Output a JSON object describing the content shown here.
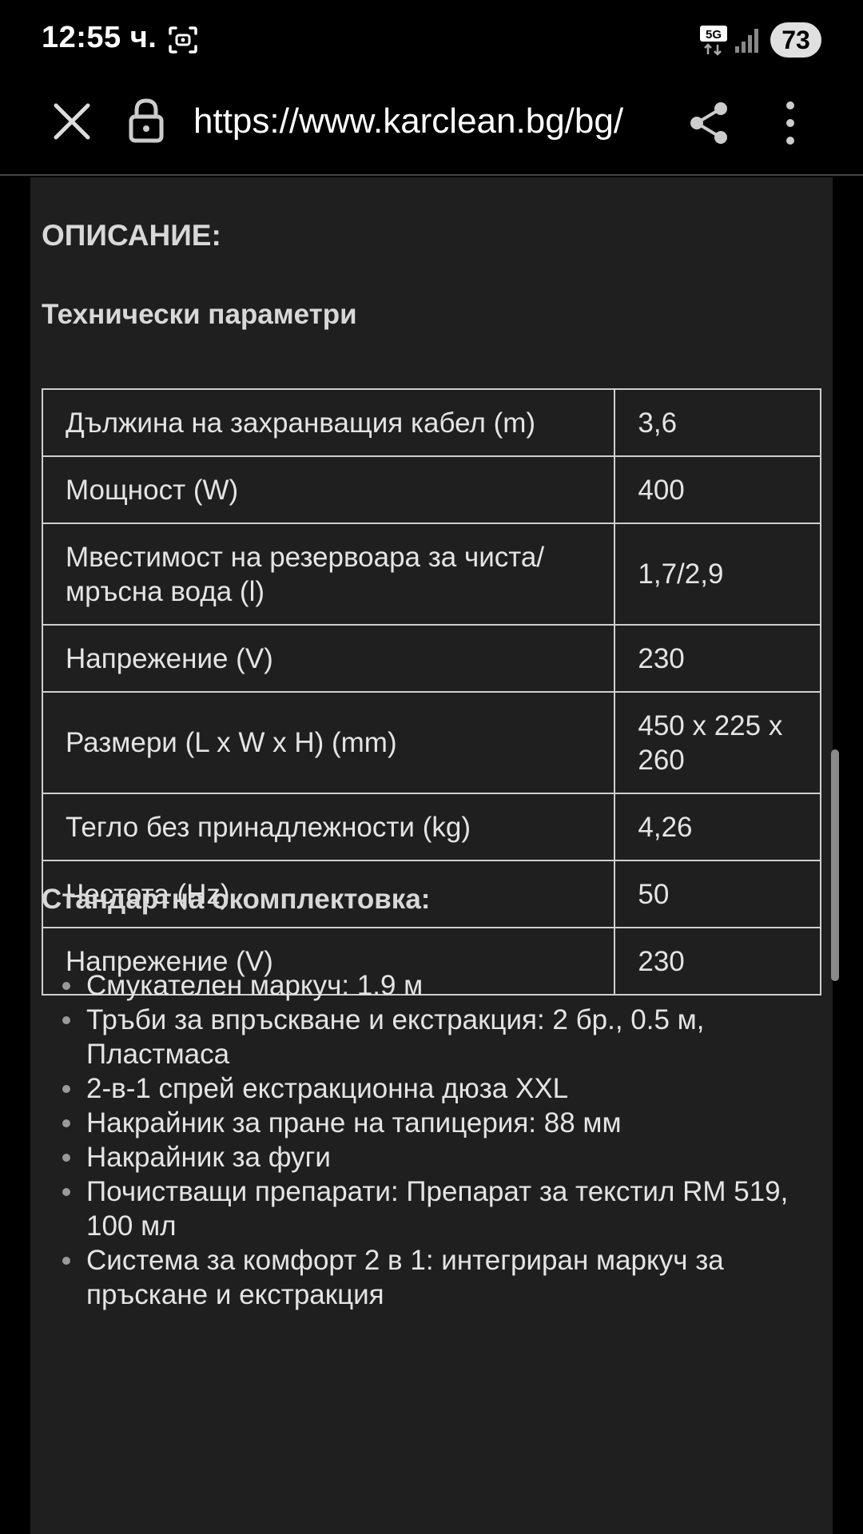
{
  "status_bar": {
    "time": "12:55 ч.",
    "network": "5G",
    "battery": "73",
    "icons": [
      "screenshot-icon",
      "5g-icon",
      "signal-icon",
      "battery-icon"
    ]
  },
  "toolbar": {
    "url": "https://www.karclean.bg/bg/",
    "icons": [
      "close-icon",
      "lock-icon",
      "share-icon",
      "more-vert-icon"
    ]
  },
  "content": {
    "description_heading": "ОПИСАНИЕ:",
    "tech_heading": "Технически параметри",
    "spec_table": [
      {
        "key": "Дължина на захранващия кабел (m)",
        "value": "3,6"
      },
      {
        "key": "Мощност (W)",
        "value": "400"
      },
      {
        "key": "Мвестимост на резервоара за чиста/ мръсна вода (l)",
        "value": "1,7/2,9"
      },
      {
        "key": "Напрежение (V)",
        "value": "230"
      },
      {
        "key": "Размери (L x W x H) (mm)",
        "value": "450 x 225 x 260"
      },
      {
        "key": "Тегло без принадлежности (kg)",
        "value": "4,26"
      },
      {
        "key": "Честота (Hz)",
        "value": "50"
      },
      {
        "key": "Напрежение (V)",
        "value": "230"
      }
    ],
    "standard_heading": "Стандартна окомплектовка:",
    "standard_items": [
      "Смукателен маркуч: 1.9 м",
      "Тръби за впръскване и екстракция: 2 бр., 0.5 м, Пластмаса",
      "2-в-1 спрей екстракционна дюза XXL",
      "Накрайник за пране на тапицерия: 88 мм",
      "Накрайник за фуги",
      "Почистващи препарати: Препарат за текстил RM 519, 100 мл",
      "Система за комфорт 2 в 1: интегриран маркуч за пръскане и екстракция"
    ]
  },
  "colors": {
    "background": "#000000",
    "panel": "#1f1f1f",
    "text": "#e4e4e4",
    "border": "#cfcfcf"
  }
}
